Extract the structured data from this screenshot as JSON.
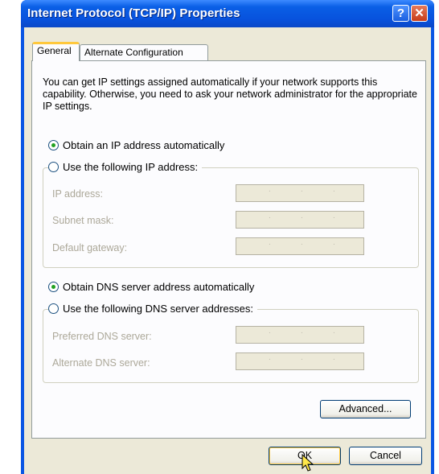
{
  "window": {
    "title": "Internet Protocol (TCP/IP) Properties",
    "help_glyph": "?",
    "close_glyph": "✕"
  },
  "tabs": [
    {
      "label": "General",
      "active": true
    },
    {
      "label": "Alternate Configuration",
      "active": false
    }
  ],
  "intro_text": "You can get IP settings assigned automatically if your network supports this capability. Otherwise, you need to ask your network administrator for the appropriate IP settings.",
  "ip_section": {
    "auto_label": "Obtain an IP address automatically",
    "manual_label": "Use the following IP address:",
    "selected": "auto",
    "fields": [
      {
        "label": "IP address:",
        "value": "",
        "enabled": false
      },
      {
        "label": "Subnet mask:",
        "value": "",
        "enabled": false
      },
      {
        "label": "Default gateway:",
        "value": "",
        "enabled": false
      }
    ]
  },
  "dns_section": {
    "auto_label": "Obtain DNS server address automatically",
    "manual_label": "Use the following DNS server addresses:",
    "selected": "auto",
    "fields": [
      {
        "label": "Preferred DNS server:",
        "value": "",
        "enabled": false
      },
      {
        "label": "Alternate DNS server:",
        "value": "",
        "enabled": false
      }
    ]
  },
  "buttons": {
    "advanced": "Advanced...",
    "ok": "OK",
    "cancel": "Cancel"
  },
  "colors": {
    "titlebar": "#0a56e4",
    "dialog_bg": "#ece9d8",
    "radio_dot": "#21a121",
    "disabled_text": "#aca899"
  },
  "icons": {
    "help": "help-icon",
    "close": "close-icon",
    "cursor": "mouse-pointer-icon"
  }
}
